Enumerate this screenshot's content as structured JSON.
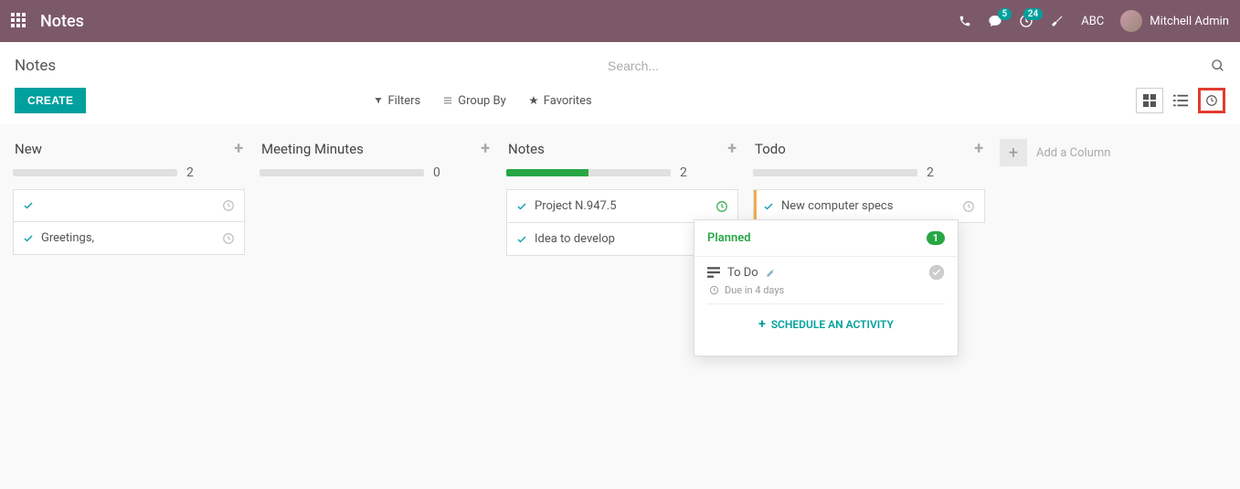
{
  "header": {
    "app_title": "Notes",
    "phone_icon": "phone-icon",
    "chat_badge": "5",
    "activity_badge": "24",
    "company": "ABC",
    "user_name": "Mitchell Admin"
  },
  "subheader": {
    "breadcrumb": "Notes",
    "search_placeholder": "Search...",
    "create_label": "CREATE",
    "filters_label": "Filters",
    "groupby_label": "Group By",
    "favorites_label": "Favorites"
  },
  "columns": [
    {
      "title": "New",
      "count": "2",
      "progress_pct": 0,
      "cards": [
        {
          "title": "",
          "clock": "grey"
        },
        {
          "title": "Greetings,",
          "clock": "grey"
        }
      ]
    },
    {
      "title": "Meeting Minutes",
      "count": "0",
      "progress_pct": 0,
      "cards": []
    },
    {
      "title": "Notes",
      "count": "2",
      "progress_pct": 50,
      "cards": [
        {
          "title": "Project N.947.5",
          "clock": "green"
        },
        {
          "title": "Idea to develop",
          "clock": "none"
        }
      ]
    },
    {
      "title": "Todo",
      "count": "2",
      "progress_pct": 0,
      "cards": [
        {
          "title": "New computer specs",
          "clock": "grey",
          "accent": true
        }
      ]
    }
  ],
  "add_column_label": "Add a Column",
  "popover": {
    "status": "Planned",
    "count": "1",
    "activity_type": "To Do",
    "due_text": "Due in 4 days",
    "schedule_label": "SCHEDULE AN ACTIVITY"
  }
}
